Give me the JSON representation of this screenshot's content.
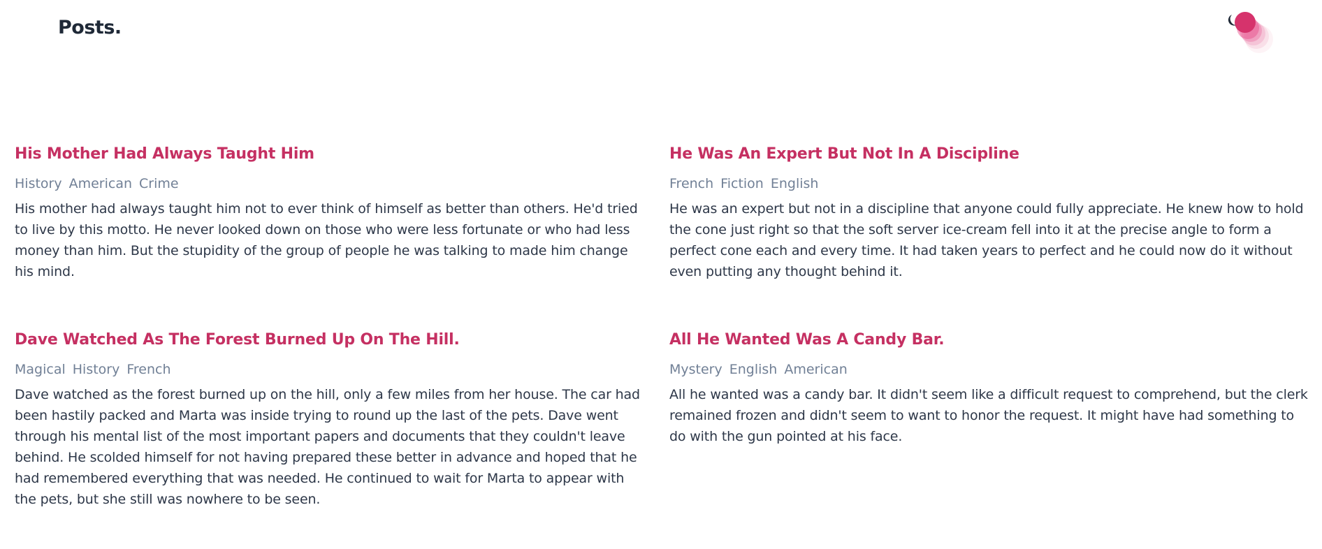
{
  "site": {
    "logo": "Posts."
  },
  "theme_toggle": {
    "icon": "moon-icon",
    "accent": "#d6336c"
  },
  "colors": {
    "title": "#c53062",
    "tag": "#718096",
    "text": "#2d3748"
  },
  "posts": [
    {
      "title": "His Mother Had Always Taught Him",
      "tags": [
        "History",
        "American",
        "Crime"
      ],
      "excerpt": "His mother had always taught him not to ever think of himself as better than others. He'd tried to live by this motto. He never looked down on those who were less fortunate or who had less money than him. But the stupidity of the group of people he was talking to made him change his mind."
    },
    {
      "title": "He Was An Expert But Not In A Discipline",
      "tags": [
        "French",
        "Fiction",
        "English"
      ],
      "excerpt": "He was an expert but not in a discipline that anyone could fully appreciate. He knew how to hold the cone just right so that the soft server ice-cream fell into it at the precise angle to form a perfect cone each and every time. It had taken years to perfect and he could now do it without even putting any thought behind it."
    },
    {
      "title": "Dave Watched As The Forest Burned Up On The Hill.",
      "tags": [
        "Magical",
        "History",
        "French"
      ],
      "excerpt": "Dave watched as the forest burned up on the hill, only a few miles from her house. The car had been hastily packed and Marta was inside trying to round up the last of the pets. Dave went through his mental list of the most important papers and documents that they couldn't leave behind. He scolded himself for not having prepared these better in advance and hoped that he had remembered everything that was needed. He continued to wait for Marta to appear with the pets, but she still was nowhere to be seen."
    },
    {
      "title": "All He Wanted Was A Candy Bar.",
      "tags": [
        "Mystery",
        "English",
        "American"
      ],
      "excerpt": "All he wanted was a candy bar. It didn't seem like a difficult request to comprehend, but the clerk remained frozen and didn't seem to want to honor the request. It might have had something to do with the gun pointed at his face."
    }
  ]
}
